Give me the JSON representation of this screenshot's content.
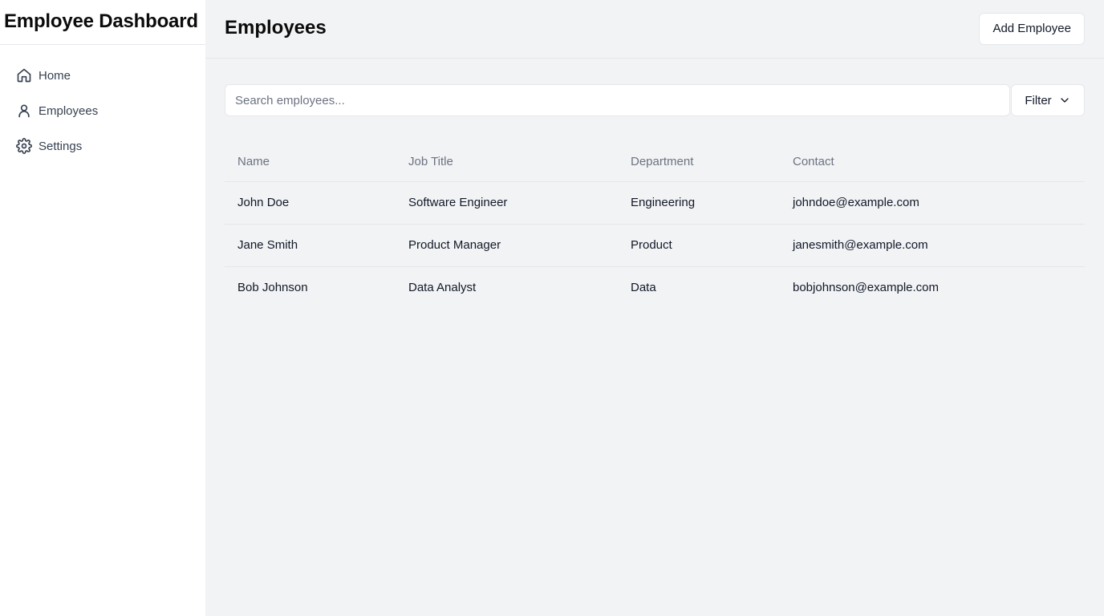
{
  "sidebar": {
    "title": "Employee Dashboard",
    "items": [
      {
        "label": "Home",
        "icon": "home-icon"
      },
      {
        "label": "Employees",
        "icon": "user-icon"
      },
      {
        "label": "Settings",
        "icon": "gear-icon"
      }
    ]
  },
  "header": {
    "title": "Employees",
    "add_button_label": "Add Employee"
  },
  "search": {
    "placeholder": "Search employees...",
    "value": "",
    "filter_label": "Filter"
  },
  "table": {
    "columns": [
      "Name",
      "Job Title",
      "Department",
      "Contact"
    ],
    "rows": [
      {
        "name": "John Doe",
        "job_title": "Software Engineer",
        "department": "Engineering",
        "contact": "johndoe@example.com"
      },
      {
        "name": "Jane Smith",
        "job_title": "Product Manager",
        "department": "Product",
        "contact": "janesmith@example.com"
      },
      {
        "name": "Bob Johnson",
        "job_title": "Data Analyst",
        "department": "Data",
        "contact": "bobjohnson@example.com"
      }
    ]
  },
  "colors": {
    "sidebar_bg": "#ffffff",
    "main_bg": "#f2f3f5",
    "border": "#e5e7eb",
    "muted_text": "#6b7280",
    "text": "#111827"
  }
}
